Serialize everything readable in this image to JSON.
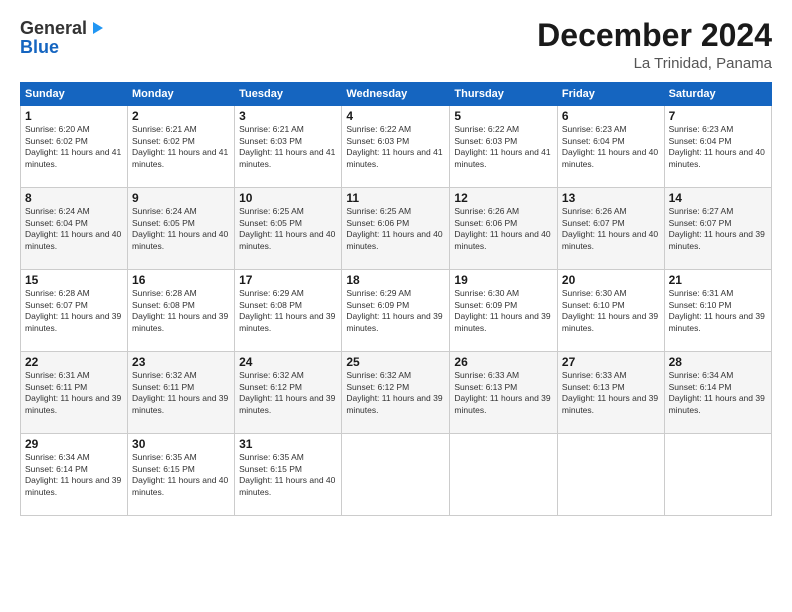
{
  "logo": {
    "line1": "General",
    "line2": "Blue"
  },
  "title": "December 2024",
  "subtitle": "La Trinidad, Panama",
  "days_of_week": [
    "Sunday",
    "Monday",
    "Tuesday",
    "Wednesday",
    "Thursday",
    "Friday",
    "Saturday"
  ],
  "weeks": [
    [
      {
        "num": "1",
        "sr": "6:20 AM",
        "ss": "6:02 PM",
        "dl": "11 hours and 41 minutes."
      },
      {
        "num": "2",
        "sr": "6:21 AM",
        "ss": "6:02 PM",
        "dl": "11 hours and 41 minutes."
      },
      {
        "num": "3",
        "sr": "6:21 AM",
        "ss": "6:03 PM",
        "dl": "11 hours and 41 minutes."
      },
      {
        "num": "4",
        "sr": "6:22 AM",
        "ss": "6:03 PM",
        "dl": "11 hours and 41 minutes."
      },
      {
        "num": "5",
        "sr": "6:22 AM",
        "ss": "6:03 PM",
        "dl": "11 hours and 41 minutes."
      },
      {
        "num": "6",
        "sr": "6:23 AM",
        "ss": "6:04 PM",
        "dl": "11 hours and 40 minutes."
      },
      {
        "num": "7",
        "sr": "6:23 AM",
        "ss": "6:04 PM",
        "dl": "11 hours and 40 minutes."
      }
    ],
    [
      {
        "num": "8",
        "sr": "6:24 AM",
        "ss": "6:04 PM",
        "dl": "11 hours and 40 minutes."
      },
      {
        "num": "9",
        "sr": "6:24 AM",
        "ss": "6:05 PM",
        "dl": "11 hours and 40 minutes."
      },
      {
        "num": "10",
        "sr": "6:25 AM",
        "ss": "6:05 PM",
        "dl": "11 hours and 40 minutes."
      },
      {
        "num": "11",
        "sr": "6:25 AM",
        "ss": "6:06 PM",
        "dl": "11 hours and 40 minutes."
      },
      {
        "num": "12",
        "sr": "6:26 AM",
        "ss": "6:06 PM",
        "dl": "11 hours and 40 minutes."
      },
      {
        "num": "13",
        "sr": "6:26 AM",
        "ss": "6:07 PM",
        "dl": "11 hours and 40 minutes."
      },
      {
        "num": "14",
        "sr": "6:27 AM",
        "ss": "6:07 PM",
        "dl": "11 hours and 39 minutes."
      }
    ],
    [
      {
        "num": "15",
        "sr": "6:28 AM",
        "ss": "6:07 PM",
        "dl": "11 hours and 39 minutes."
      },
      {
        "num": "16",
        "sr": "6:28 AM",
        "ss": "6:08 PM",
        "dl": "11 hours and 39 minutes."
      },
      {
        "num": "17",
        "sr": "6:29 AM",
        "ss": "6:08 PM",
        "dl": "11 hours and 39 minutes."
      },
      {
        "num": "18",
        "sr": "6:29 AM",
        "ss": "6:09 PM",
        "dl": "11 hours and 39 minutes."
      },
      {
        "num": "19",
        "sr": "6:30 AM",
        "ss": "6:09 PM",
        "dl": "11 hours and 39 minutes."
      },
      {
        "num": "20",
        "sr": "6:30 AM",
        "ss": "6:10 PM",
        "dl": "11 hours and 39 minutes."
      },
      {
        "num": "21",
        "sr": "6:31 AM",
        "ss": "6:10 PM",
        "dl": "11 hours and 39 minutes."
      }
    ],
    [
      {
        "num": "22",
        "sr": "6:31 AM",
        "ss": "6:11 PM",
        "dl": "11 hours and 39 minutes."
      },
      {
        "num": "23",
        "sr": "6:32 AM",
        "ss": "6:11 PM",
        "dl": "11 hours and 39 minutes."
      },
      {
        "num": "24",
        "sr": "6:32 AM",
        "ss": "6:12 PM",
        "dl": "11 hours and 39 minutes."
      },
      {
        "num": "25",
        "sr": "6:32 AM",
        "ss": "6:12 PM",
        "dl": "11 hours and 39 minutes."
      },
      {
        "num": "26",
        "sr": "6:33 AM",
        "ss": "6:13 PM",
        "dl": "11 hours and 39 minutes."
      },
      {
        "num": "27",
        "sr": "6:33 AM",
        "ss": "6:13 PM",
        "dl": "11 hours and 39 minutes."
      },
      {
        "num": "28",
        "sr": "6:34 AM",
        "ss": "6:14 PM",
        "dl": "11 hours and 39 minutes."
      }
    ],
    [
      {
        "num": "29",
        "sr": "6:34 AM",
        "ss": "6:14 PM",
        "dl": "11 hours and 39 minutes."
      },
      {
        "num": "30",
        "sr": "6:35 AM",
        "ss": "6:15 PM",
        "dl": "11 hours and 40 minutes."
      },
      {
        "num": "31",
        "sr": "6:35 AM",
        "ss": "6:15 PM",
        "dl": "11 hours and 40 minutes."
      },
      null,
      null,
      null,
      null
    ]
  ],
  "labels": {
    "sunrise": "Sunrise:",
    "sunset": "Sunset:",
    "daylight": "Daylight: 11 hours"
  }
}
